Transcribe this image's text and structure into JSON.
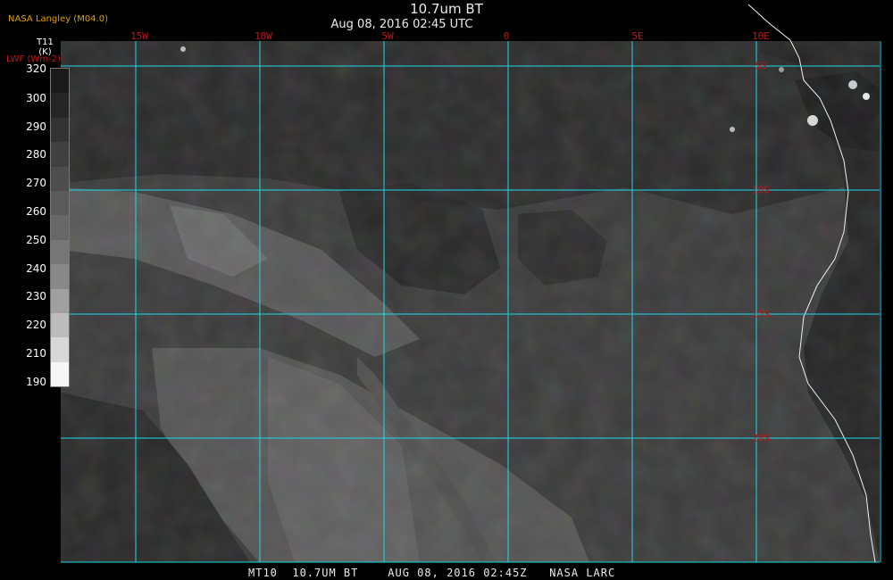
{
  "header": {
    "source": "NASA Langley (M04.0)",
    "title": "10.7um BT",
    "subtitle": "Aug 08, 2016 02:45 UTC"
  },
  "colorbar": {
    "variable": "T11",
    "unit": "(K)",
    "alt_label": "LWF (Wm-2)",
    "ticks": [
      "320",
      "300",
      "290",
      "280",
      "270",
      "260",
      "250",
      "240",
      "230",
      "220",
      "210",
      "190"
    ],
    "shades": [
      "#1a1a1a",
      "#262626",
      "#333333",
      "#404040",
      "#4d4d4d",
      "#5a5a5a",
      "#676767",
      "#767676",
      "#888888",
      "#a0a0a0",
      "#bcbcbc",
      "#d8d8d8",
      "#f6f6f6"
    ]
  },
  "grid": {
    "line_color": "#20d8e6",
    "lon_labels": [
      "15W",
      "10W",
      "5W",
      "0",
      "5E",
      "10E"
    ],
    "lat_labels": [
      "5S",
      "10S",
      "15S",
      "20S"
    ]
  },
  "footer": {
    "text": "MT10  10.7UM BT    AUG 08, 2016 02:45Z   NASA LARC"
  }
}
